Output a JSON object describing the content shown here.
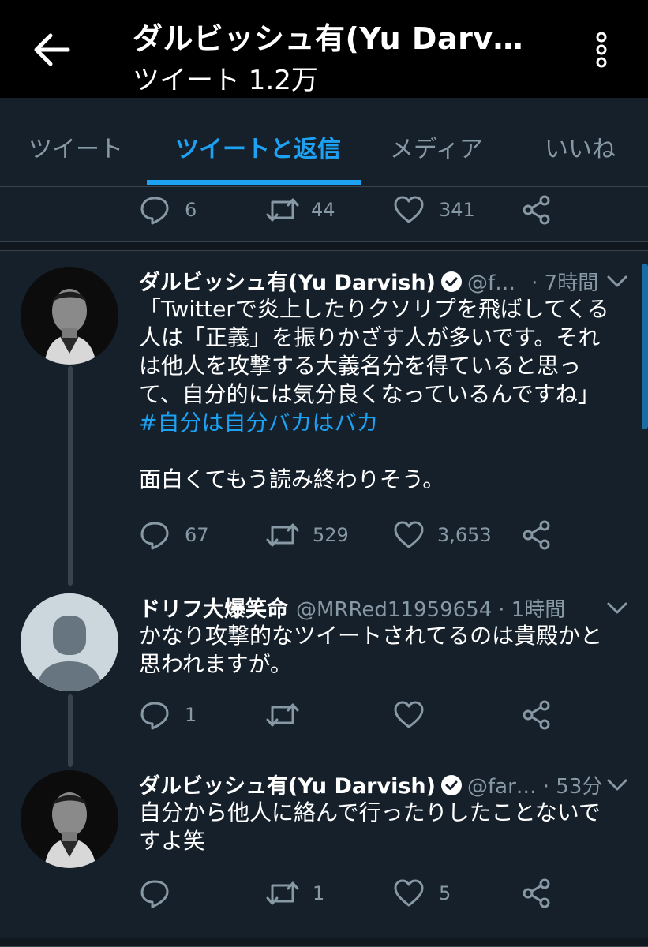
{
  "header": {
    "title": "ダルビッシュ有(Yu Darv…",
    "subtitle": "ツイート 1.2万"
  },
  "tabs": [
    {
      "label": "ツイート"
    },
    {
      "label": "ツイートと返信",
      "active": true
    },
    {
      "label": "メディア"
    },
    {
      "label": "いいね"
    }
  ],
  "top_actions": {
    "replies": "6",
    "retweets": "44",
    "likes": "341"
  },
  "tweets": [
    {
      "name": "ダルビッシュ有(Yu Darvish)",
      "verified": true,
      "handle": "@f…",
      "time": "· 7時間",
      "lines": [
        "「Twitterで炎上したりクソリプを飛ばしてくる",
        "人は「正義」を振りかざす人が多いです。それ",
        "は他人を攻撃する大義名分を得ていると思っ",
        "て、自分的には気分良くなっているんですね」"
      ],
      "hashtag": "#自分は自分バカはバカ",
      "extra": "面白くてもう読み終わりそう。",
      "replies": "67",
      "retweets": "529",
      "likes": "3,653"
    },
    {
      "name": "ドリフ大爆笑命",
      "verified": false,
      "handle": "@MRRed11959654",
      "time": "· 1時間",
      "lines": [
        "かなり攻撃的なツイートされてるのは貴殿かと",
        "思われますが。"
      ],
      "replies": "1",
      "retweets": "",
      "likes": ""
    },
    {
      "name": "ダルビッシュ有(Yu Darvish)",
      "verified": true,
      "handle": "@far…",
      "time": "· 53分",
      "lines": [
        "自分から他人に絡んで行ったりしたことないで",
        "すよ笑"
      ],
      "replies": "",
      "retweets": "1",
      "likes": "5"
    }
  ],
  "icons": [
    "back-arrow-icon",
    "more-vertical-icon",
    "reply-icon",
    "retweet-icon",
    "like-icon",
    "share-icon",
    "verified-badge-icon",
    "chevron-down-icon",
    "default-avatar-icon"
  ],
  "colors": {
    "background": "#15202b",
    "header": "#000000",
    "accent": "#1da1f2",
    "muted": "#8899a6",
    "border": "#38444d"
  }
}
